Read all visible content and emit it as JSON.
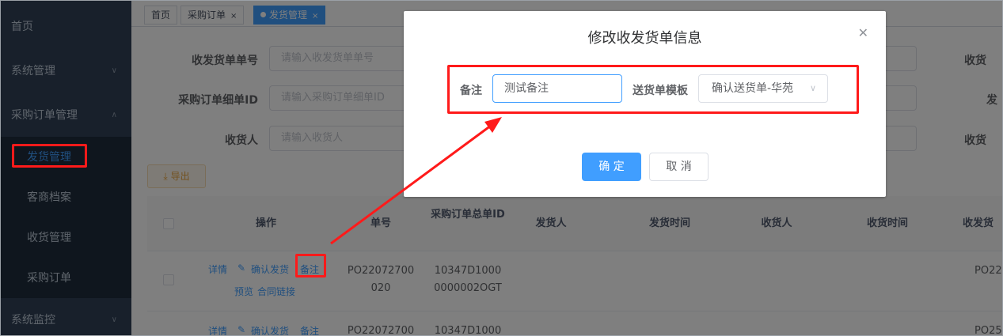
{
  "sidebar": {
    "items": [
      {
        "label": "首页"
      },
      {
        "label": "系统管理",
        "chevron": "chevron-down-icon"
      },
      {
        "label": "采购订单管理",
        "chevron": "chevron-up-icon"
      },
      {
        "label": "系统监控",
        "chevron": "chevron-down-icon"
      }
    ],
    "subitems": [
      {
        "label": "发货管理",
        "active": true
      },
      {
        "label": "客商档案"
      },
      {
        "label": "收货管理"
      },
      {
        "label": "采购订单"
      }
    ]
  },
  "tags": [
    {
      "label": "首页"
    },
    {
      "label": "采购订单",
      "close": "×"
    },
    {
      "label": "发货管理",
      "close": "×",
      "active": true
    }
  ],
  "search_form": {
    "fields": [
      {
        "label": "收发货单单号",
        "placeholder": "请输入收发货单单号"
      },
      {
        "label": "采购订单细单ID",
        "placeholder": "请输入采购订单细单ID"
      },
      {
        "label": "收货人",
        "placeholder": "请输入收货人"
      }
    ],
    "right_labels": [
      "收货",
      "发",
      "收货"
    ]
  },
  "toolbar": {
    "export_label": "导出",
    "export_icon": "download-icon"
  },
  "table": {
    "columns": [
      "操作",
      "单号",
      "采购订单总单ID",
      "发货人",
      "发货时间",
      "收货人",
      "收货时间",
      "收发货"
    ],
    "rows": [
      {
        "actions": {
          "detail": "详情",
          "confirm": "确认发货",
          "remark": "备注",
          "preview": "预览",
          "contract": "合同链接"
        },
        "order_no": "PO22072700020",
        "total_id": "10347D10000000002OGT",
        "last_col": "PO22"
      },
      {
        "actions": {
          "detail": "详情",
          "confirm": "确认发货",
          "remark": "备注"
        },
        "order_no": "PO22072700",
        "total_id": "10347D1000",
        "last_col": "PO25"
      }
    ]
  },
  "dialog": {
    "title": "修改收发货单信息",
    "remark_label": "备注",
    "remark_value": "测试备注",
    "template_label": "送货单模板",
    "template_value": "确认送货单-华苑",
    "confirm_label": "确 定",
    "cancel_label": "取 消"
  },
  "colors": {
    "primary": "#409eff",
    "sidebar": "#304156",
    "annotation": "#ff1a1a"
  }
}
